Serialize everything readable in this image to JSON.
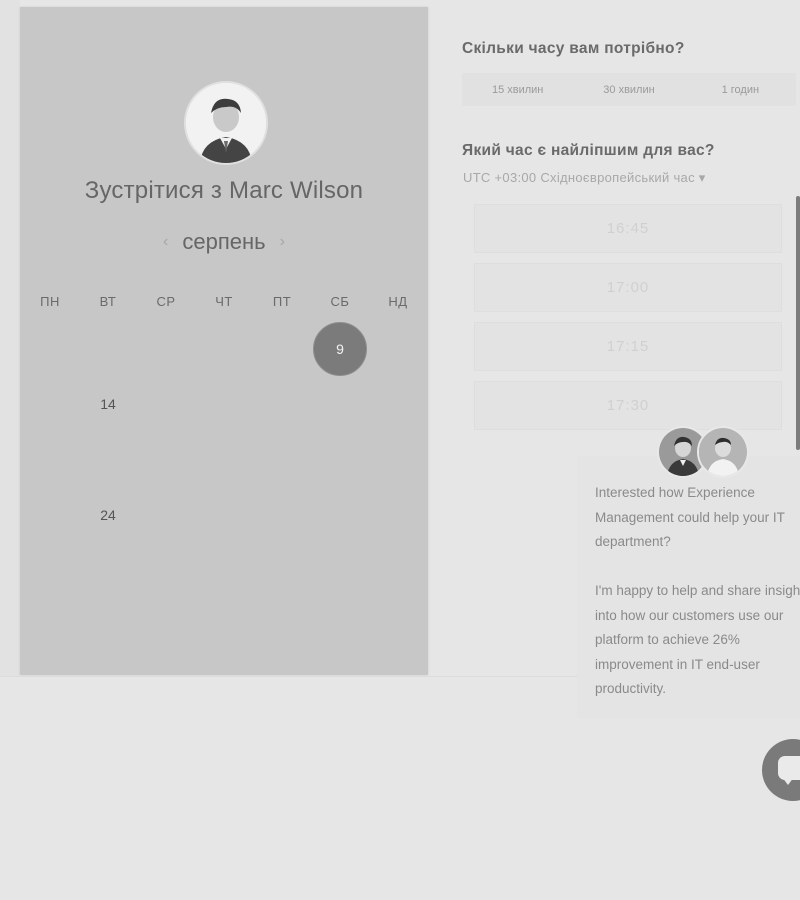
{
  "calendar": {
    "meet_title": "Зустрітися з Marc Wilson",
    "month": "серпень",
    "weekdays": [
      "ПН",
      "ВТ",
      "СР",
      "ЧТ",
      "ПТ",
      "СБ",
      "НД"
    ],
    "weeks": [
      [
        "",
        "",
        "",
        "",
        "",
        "9",
        ""
      ],
      [
        "",
        "14",
        "",
        "",
        "",
        "",
        ""
      ],
      [
        "",
        "",
        "",
        "",
        "",
        "",
        ""
      ],
      [
        "",
        "24",
        "",
        "",
        "",
        "",
        ""
      ],
      [
        "",
        "",
        "",
        "",
        "",
        "",
        ""
      ]
    ],
    "selected_day": "9",
    "enabled_days": [
      "9",
      "14",
      "24"
    ]
  },
  "duration": {
    "question": "Скільки часу вам потрібно?",
    "options": [
      "15 хвилин",
      "30 хвилин",
      "1 годин"
    ]
  },
  "time": {
    "question": "Який час є найліпшим для вас?",
    "timezone": "UTC +03:00 Східноєвропейський час ▾",
    "slots": [
      "16:45",
      "17:00",
      "17:15",
      "17:30"
    ]
  },
  "chat": {
    "message_1": "Interested how Experience Management could help your IT department?",
    "message_2": "I'm happy to help and share insight into how our customers use our platform to achieve 26% improvement in IT end-user productivity."
  },
  "icons": {
    "prev_month": "chevron-left-icon",
    "next_month": "chevron-right-icon",
    "chat": "chat-bubble-icon",
    "avatar": "person-avatar"
  },
  "colors": {
    "panel": "#c7c7c7",
    "selected": "#7b7b7b",
    "background": "#e6e6e6"
  }
}
